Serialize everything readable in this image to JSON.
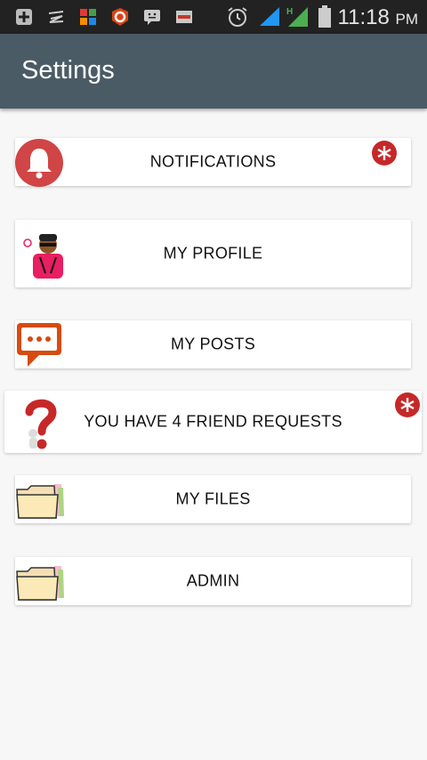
{
  "status_bar": {
    "time": "11:18",
    "ampm": "PM",
    "icons": [
      "plus-icon",
      "signal-swipe-icon",
      "apps-icon",
      "browser-icon",
      "chat-icon",
      "app-icon",
      "alarm-icon",
      "wifi-icon",
      "mobile-signal-icon",
      "battery-icon"
    ]
  },
  "app_bar": {
    "title": "Settings"
  },
  "menu": [
    {
      "label": "NOTIFICATIONS",
      "icon": "bell-icon",
      "badge": true
    },
    {
      "label": "MY PROFILE",
      "icon": "profile-avatar-icon",
      "badge": false
    },
    {
      "label": "MY POSTS",
      "icon": "chat-bubble-icon",
      "badge": false
    },
    {
      "label": "YOU HAVE 4 FRIEND REQUESTS",
      "icon": "question-mark-icon",
      "badge": true
    },
    {
      "label": "MY FILES",
      "icon": "folder-icon",
      "badge": false
    },
    {
      "label": "ADMIN",
      "icon": "folder-icon",
      "badge": false
    }
  ],
  "colors": {
    "app_bar": "#4b5b66",
    "status_bar": "#222222",
    "badge": "#c62828",
    "bell": "#d04545",
    "posts": "#d64b10"
  }
}
